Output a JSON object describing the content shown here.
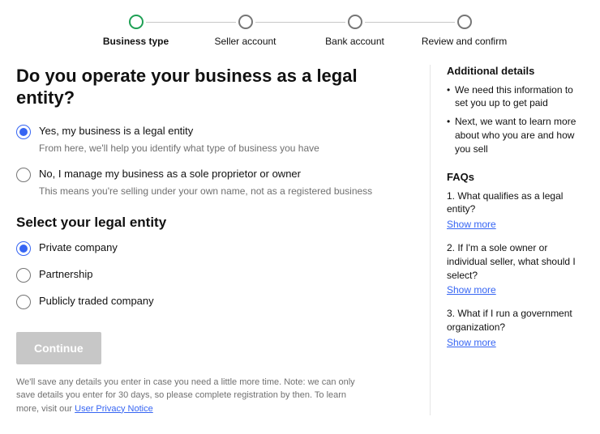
{
  "stepper": {
    "steps": [
      {
        "label": "Business type"
      },
      {
        "label": "Seller account"
      },
      {
        "label": "Bank account"
      },
      {
        "label": "Review and confirm"
      }
    ]
  },
  "main": {
    "heading": "Do you operate your business as a legal entity?",
    "q1": {
      "opt1": {
        "label": "Yes, my business is a legal entity",
        "desc": "From here, we'll help you identify what type of business you have"
      },
      "opt2": {
        "label": "No, I manage my business as a sole proprietor or owner",
        "desc": "This means you're selling under your own name, not as a registered business"
      }
    },
    "subheading": "Select your legal entity",
    "q2": {
      "opt1": {
        "label": "Private company"
      },
      "opt2": {
        "label": "Partnership"
      },
      "opt3": {
        "label": "Publicly traded company"
      }
    },
    "continue": "Continue",
    "footnote_text": "We'll save any details you enter in case you need a little more time. Note: we can only save details you enter for 30 days, so please complete registration by then. To learn more, visit our ",
    "footnote_link": "User Privacy Notice"
  },
  "sidebar": {
    "details_heading": "Additional details",
    "details": [
      "We need this information to set you up to get paid",
      "Next, we want to learn more about who you are and how you sell"
    ],
    "faqs_heading": "FAQs",
    "show_more": "Show more",
    "faqs": [
      "1. What qualifies as a legal entity?",
      "2. If I'm a sole owner or individual seller, what should I select?",
      "3. What if I run a government organization?"
    ]
  }
}
